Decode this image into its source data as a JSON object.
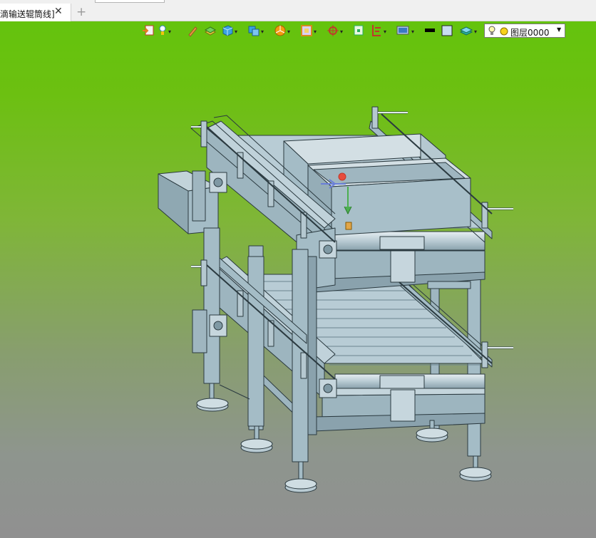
{
  "document": {
    "tab_label": "滴输送辊筒线]",
    "close_glyph": "✕",
    "add_glyph": "+"
  },
  "toolbar": {
    "icons": [
      "import-icon",
      "light-icon",
      "pen-icon",
      "box-stack-icon",
      "cube-icon",
      "cube-pair-icon",
      "pie-icon",
      "frame-icon",
      "target-icon",
      "fit-view-icon",
      "align-icon",
      "display-icon",
      "line-color-swatch",
      "fill-color-swatch",
      "layers-icon"
    ],
    "line_color": "#000000",
    "fill_color": "#c8dcf0"
  },
  "layer": {
    "label": "图层0000",
    "bulb": "light-bulb-icon",
    "sun": "sun-icon"
  },
  "colors": {
    "viewport_top": "#64c30d",
    "viewport_bottom": "#909090",
    "model_fill": "#a4bcc6",
    "model_stroke": "#2b3a40"
  }
}
